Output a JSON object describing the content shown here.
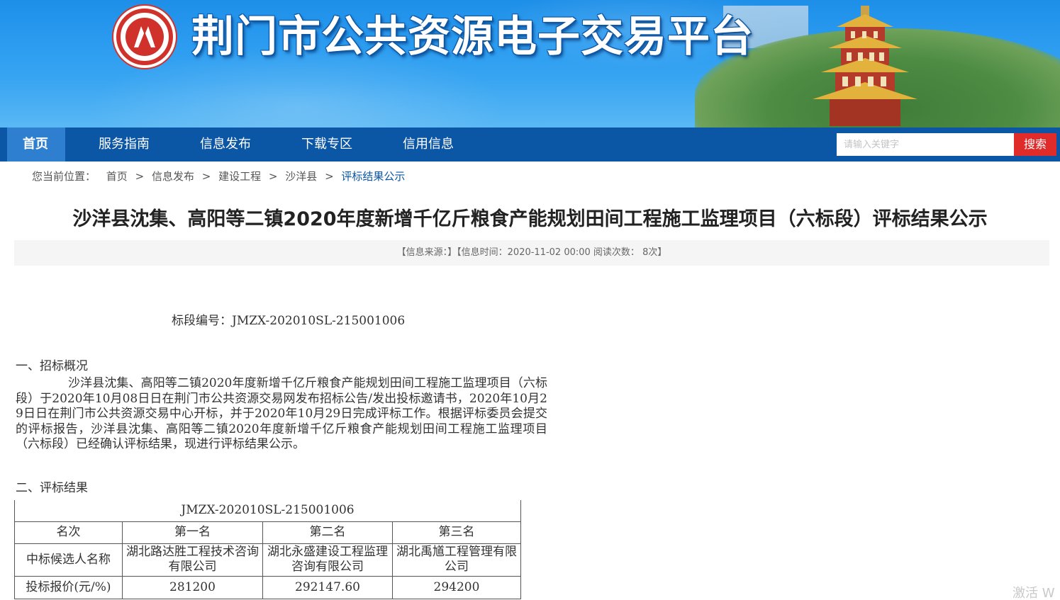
{
  "header": {
    "site_title": "荆门市公共资源电子交易平台",
    "logo_alt": "JINGMEN PUBLIC RESOURCES TRADING",
    "colors": {
      "banner": "#2b9cf0",
      "nav": "#0b56a5",
      "nav_active": "#2f7fd0",
      "search_button": "#e02b2b"
    }
  },
  "nav": {
    "items": [
      {
        "label": "首页",
        "active": true
      },
      {
        "label": "服务指南"
      },
      {
        "label": "信息发布"
      },
      {
        "label": "下载专区"
      },
      {
        "label": "信用信息"
      }
    ],
    "search": {
      "placeholder": "请输入关键字",
      "button_label": "搜索"
    }
  },
  "breadcrumb": {
    "prefix": "您当前位置：",
    "items": [
      "首页",
      "信息发布",
      "建设工程",
      "沙洋县",
      "评标结果公示"
    ],
    "separator": ">"
  },
  "article": {
    "title": "沙洋县沈集、高阳等二镇2020年度新增千亿斤粮食产能规划田间工程施工监理项目（六标段）评标结果公示",
    "meta": "【信息来源：】【信息时间：2020-11-02 00:00   阅读次数：  8次】",
    "section_code": "标段编号：JMZX-202010SL-215001006",
    "heading_1": "一、招标概况",
    "paragraph_1": "沙洋县沈集、高阳等二镇2020年度新增千亿斤粮食产能规划田间工程施工监理项目（六标段）于2020年10月08日日在荆门市公共资源交易网发布招标公告/发出投标邀请书，2020年10月29日日在荆门市公共资源交易中心开标，并于2020年10月29日完成评标工作。根据评标委员会提交的评标报告，沙洋县沈集、高阳等二镇2020年度新增千亿斤粮食产能规划田间工程施工监理项目（六标段）已经确认评标结果，现进行评标结果公示。",
    "heading_2": "二、评标结果"
  },
  "result_table": {
    "code": "JMZX-202010SL-215001006",
    "headers": [
      "名次",
      "第一名",
      "第二名",
      "第三名"
    ],
    "rows": [
      [
        "中标候选人名称",
        "湖北路达胜工程技术咨询有限公司",
        "湖北永盛建设工程监理咨询有限公司",
        "湖北禹馗工程管理有限公司"
      ],
      [
        "投标报价(元/%)",
        "281200",
        "292147.60",
        "294200"
      ]
    ]
  },
  "watermark": "激活 W"
}
